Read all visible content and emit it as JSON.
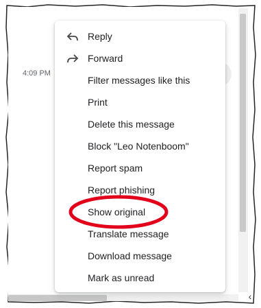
{
  "message": {
    "time": "4:09 PM"
  },
  "menu": {
    "items": [
      {
        "label": "Reply",
        "icon": "reply-icon"
      },
      {
        "label": "Forward",
        "icon": "forward-icon"
      },
      {
        "label": "Filter messages like this"
      },
      {
        "label": "Print"
      },
      {
        "label": "Delete this message"
      },
      {
        "label": "Block \"Leo Notenboom\""
      },
      {
        "label": "Report spam"
      },
      {
        "label": "Report phishing"
      },
      {
        "label": "Show original"
      },
      {
        "label": "Translate message"
      },
      {
        "label": "Download message"
      },
      {
        "label": "Mark as unread"
      }
    ]
  },
  "colors": {
    "highlight": "#e3001b",
    "menu_text": "#202124",
    "icon": "#444746",
    "scrollbar": "#c9c9c9"
  },
  "scrollbar": {
    "left_arrow": "‹"
  }
}
